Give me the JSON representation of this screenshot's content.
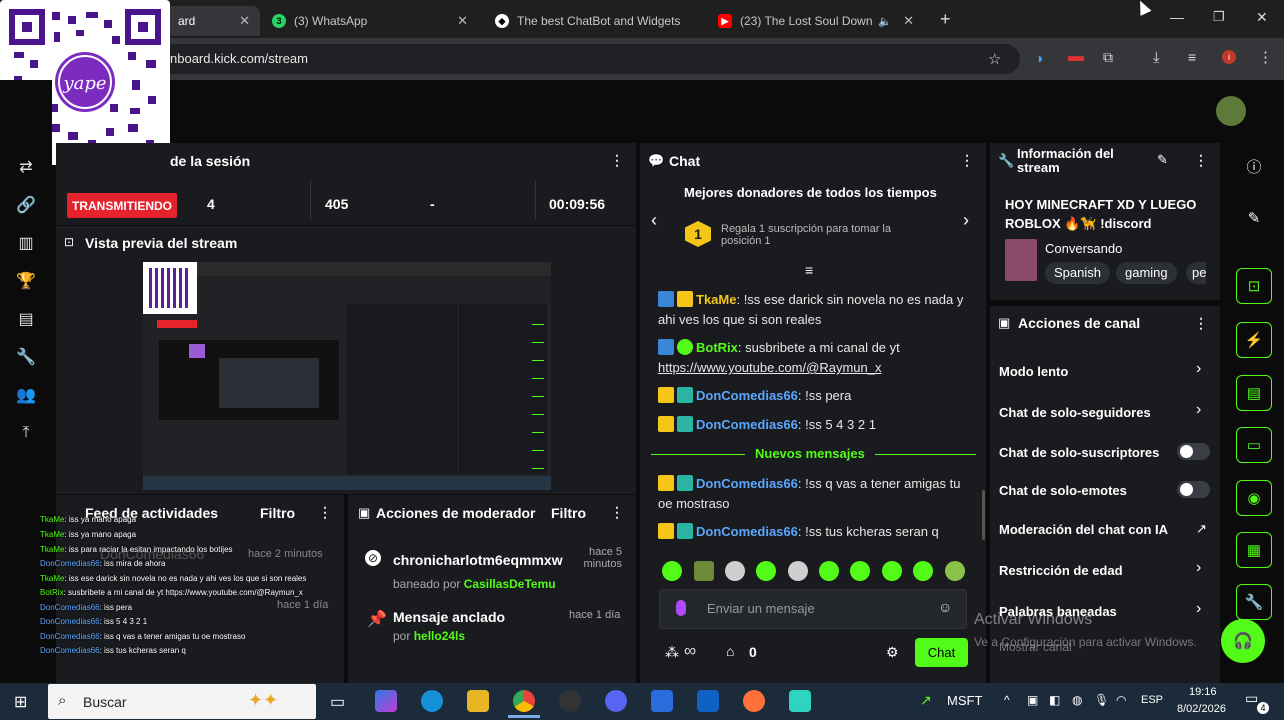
{
  "browser": {
    "tabs": [
      {
        "label": "ard"
      },
      {
        "label": "(3) WhatsApp"
      },
      {
        "label": "The best ChatBot and Widgets"
      },
      {
        "label": "(23) The Lost Soul Down"
      }
    ],
    "url": "nboard.kick.com/stream",
    "new_tab": "+"
  },
  "qr": {
    "brand": "yape"
  },
  "session": {
    "title": "de la sesión",
    "live_badge": "TRANSMITIENDO",
    "stats": [
      "4",
      "405",
      "-",
      "00:09:56"
    ]
  },
  "preview": {
    "title": "Vista previa del stream"
  },
  "activity": {
    "title": "Feed de actividades",
    "filter": "Filtro",
    "overlay_lines": [
      {
        "user": "TkaMe",
        "text": ": iss ya mano apaga"
      },
      {
        "user": "TkaMe",
        "text": ": iss ya mano apaga"
      },
      {
        "user": "TkaMe",
        "text": ": iss para raciar la esitan impactando los botijes"
      },
      {
        "user": "DonComedias66",
        "text": ": iss mira de ahora"
      },
      {
        "user": "TkaMe",
        "text": ": iss ese darick sin novela no es nada y ahi ves los que si son reales"
      },
      {
        "user": "BotRix",
        "text": ": susbribete a mi canal de yt https://www.youtube.com/@Raymun_x"
      },
      {
        "user": "DonComedias66",
        "text": ": iss pera"
      },
      {
        "user": "DonComedias66",
        "text": ": iss 5 4 3 2 1"
      },
      {
        "user": "DonComedias66",
        "text": ": iss q vas a tener amigas tu oe mostraso"
      },
      {
        "user": "DonComedias66",
        "text": ": iss tus kcheras seran q"
      }
    ],
    "bg_user": "DonComedias66",
    "bg_time1": "hace 2 minutos",
    "bg_time2": "hace 1 día"
  },
  "moderator": {
    "title": "Acciones de moderador",
    "filter": "Filtro",
    "ban_user": "chronicharlotm6eqmmxw",
    "ban_time": "hace 5 minutos",
    "ban_by_label": "baneado por",
    "ban_by": "CasillasDeTemu",
    "pinned_title": "Mensaje anclado",
    "pinned_time": "hace 1 día",
    "pinned_by_label": "por",
    "pinned_by": "hello24ls"
  },
  "chat": {
    "title": "Chat",
    "top_donors": "Mejores donadores de todos los tiempos",
    "gift_rank": "1",
    "gift_text": "Regala 1 suscripción para tomar la posición 1",
    "messages": [
      {
        "user": "TkaMe",
        "color": "#f5c518",
        "text": ": !ss ese darick sin novela no es nada y ahi ves los que si son reales"
      },
      {
        "user": "BotRix",
        "color": "#53fc18",
        "text": ": susbribete a mi canal de yt ",
        "link": "https://www.youtube.com/@Raymun_x"
      },
      {
        "user": "DonComedias66",
        "color": "#5ba7ff",
        "text": ": !ss pera"
      },
      {
        "user": "DonComedias66",
        "color": "#5ba7ff",
        "text": ": !ss 5 4 3 2 1"
      },
      {
        "user": "DonComedias66",
        "color": "#5ba7ff",
        "text": ": !ss q vas a tener amigas tu oe mostraso"
      },
      {
        "user": "DonComedias66",
        "color": "#5ba7ff",
        "text": ": !ss tus kcheras seran q"
      }
    ],
    "new_messages": "Nuevos mensajes",
    "input_placeholder": "Enviar un mensaje",
    "infinity": "∞",
    "store_count": "0",
    "send_label": "Chat"
  },
  "info": {
    "title": "Información del stream",
    "stream_title": "HOY MINECRAFT XD Y LUEGO ROBLOX 🔥🦮 !discord",
    "category": "Conversando",
    "tags": [
      "Spanish",
      "gaming",
      "pe"
    ]
  },
  "actions": {
    "title": "Acciones de canal",
    "rows": [
      "Modo lento",
      "Chat de solo-seguidores",
      "Chat de solo-suscriptores",
      "Chat de solo-emotes",
      "Moderación del chat con IA",
      "Restricción de edad",
      "Palabras baneadas",
      "Mostrar canal"
    ]
  },
  "watermark": {
    "line1": "Activar Windows",
    "line2": "Ve a Configuración para activar Windows."
  },
  "taskbar": {
    "search": "Buscar",
    "ticker": "MSFT",
    "lang": "ESP",
    "time": "19:16",
    "date": "8/02/2026",
    "notif": "4"
  },
  "colors": {
    "kick_green": "#53fc18",
    "live_red": "#e6232d",
    "user_blue": "#5ba7ff",
    "gold": "#f5c518"
  }
}
